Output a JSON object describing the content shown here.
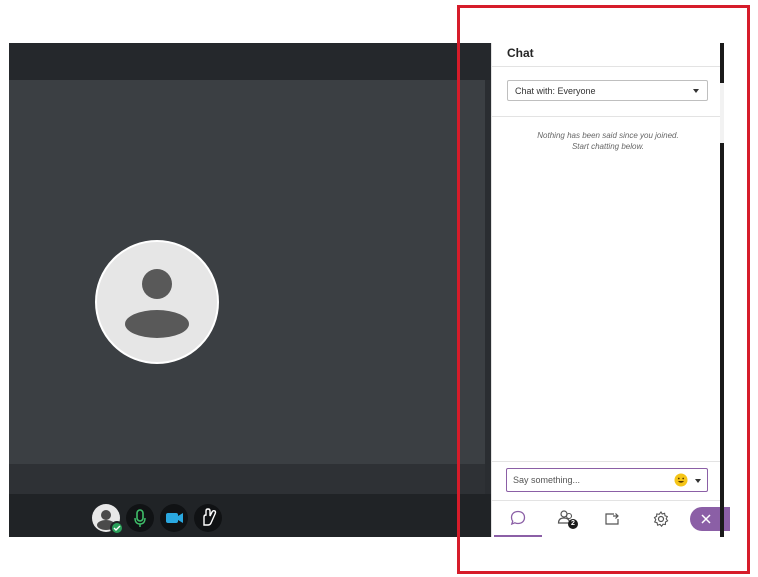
{
  "chat": {
    "title": "Chat",
    "chat_with": "Chat with: Everyone",
    "empty_line1": "Nothing has been said since you joined.",
    "empty_line2": "Start chatting below.",
    "input_placeholder": "Say something...",
    "attendees_count": "2"
  },
  "colors": {
    "accent": "#8b5fa6",
    "highlight": "#d61c2a",
    "status_green": "#2aa05a",
    "camera_blue": "#2aa8e0"
  },
  "icons": {
    "controls": [
      "user-avatar-icon",
      "microphone-icon",
      "camera-icon",
      "raise-hand-icon"
    ],
    "tabs": [
      "chat-bubble-icon",
      "attendees-icon",
      "share-content-icon",
      "settings-gear-icon",
      "close-icon"
    ],
    "emoji": "smiley-emoji-icon"
  }
}
